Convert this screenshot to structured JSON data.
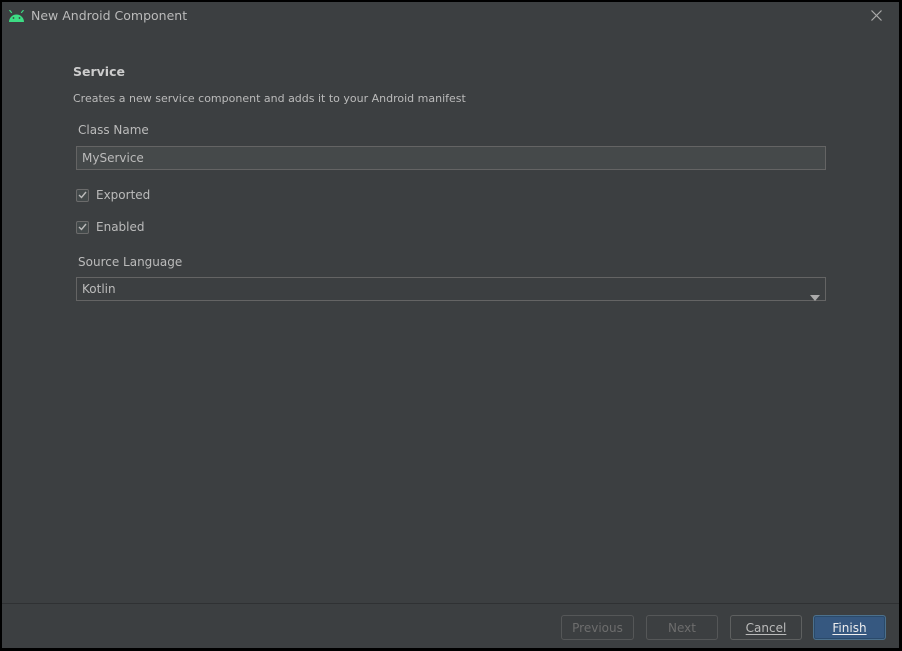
{
  "window": {
    "title": "New Android Component",
    "app_icon": "android-icon",
    "close_icon": "close-icon"
  },
  "section": {
    "title": "Service",
    "description": "Creates a new service component and adds it to your Android manifest"
  },
  "form": {
    "class_name_label": "Class Name",
    "class_name_value": "MyService",
    "exported_label": "Exported",
    "exported_checked": true,
    "enabled_label": "Enabled",
    "enabled_checked": true,
    "source_language_label": "Source Language",
    "source_language_value": "Kotlin"
  },
  "footer": {
    "previous_label": "Previous",
    "next_label": "Next",
    "cancel_label": "Cancel",
    "finish_label": "Finish"
  },
  "colors": {
    "background": "#3c3f41",
    "android_green": "#3ddc84",
    "primary_button": "#365880"
  }
}
